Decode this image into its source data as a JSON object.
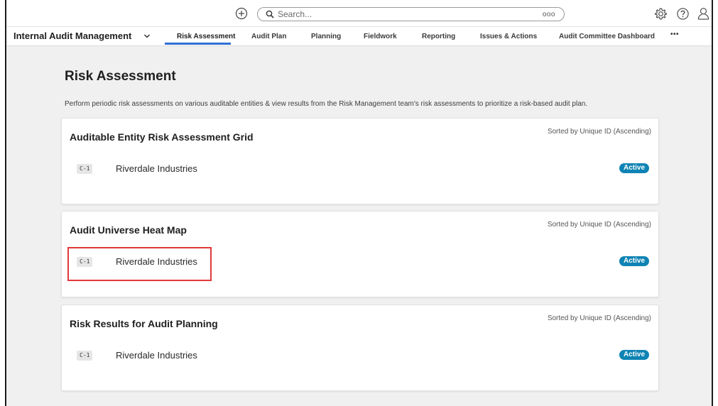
{
  "topbar": {
    "search_placeholder": "Search...",
    "search_more": "ooo",
    "icons": [
      "add-icon",
      "search-icon",
      "more-icon",
      "gear-icon",
      "help-icon",
      "user-icon"
    ]
  },
  "nav": {
    "app_name": "Internal Audit Management",
    "tabs": [
      {
        "label": "Risk Assessment",
        "active": true
      },
      {
        "label": "Audit Plan"
      },
      {
        "label": "Planning"
      },
      {
        "label": "Fieldwork"
      },
      {
        "label": "Reporting"
      },
      {
        "label": "Issues & Actions"
      },
      {
        "label": "Audit Committee Dashboard"
      }
    ],
    "more": "•••"
  },
  "page": {
    "title": "Risk Assessment",
    "description": "Perform periodic risk assessments on various auditable entities & view results from the Risk Management team's risk assessments to prioritize a risk-based audit plan."
  },
  "cards": [
    {
      "title": "Auditable Entity Risk Assessment Grid",
      "sort": "Sorted by Unique ID (Ascending)",
      "rows": [
        {
          "id": "C-1",
          "name": "Riverdale Industries",
          "status": "Active"
        }
      ]
    },
    {
      "title": "Audit Universe Heat Map",
      "sort": "Sorted by Unique ID (Ascending)",
      "rows": [
        {
          "id": "C-1",
          "name": "Riverdale Industries",
          "status": "Active"
        }
      ]
    },
    {
      "title": "Risk Results for Audit Planning",
      "sort": "Sorted by Unique ID (Ascending)",
      "rows": [
        {
          "id": "C-1",
          "name": "Riverdale Industries",
          "status": "Active"
        }
      ]
    }
  ],
  "colors": {
    "accent": "#2f6fd6",
    "badge": "#0e83b4",
    "highlight": "#e0383b",
    "content_bg": "#f0f0f0"
  }
}
